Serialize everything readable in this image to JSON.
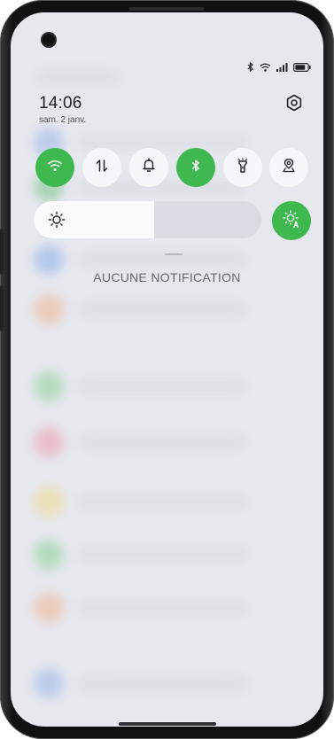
{
  "status_bar": {
    "icons": [
      "bluetooth-icon",
      "wifi-icon",
      "signal-icon",
      "battery-icon"
    ]
  },
  "header": {
    "time": "14:06",
    "date": "sam. 2 janv.",
    "settings_icon": "gear-icon"
  },
  "quick_toggles": [
    {
      "name": "wifi",
      "icon": "wifi-icon",
      "state": "on"
    },
    {
      "name": "mobile-data",
      "icon": "data-arrows-icon",
      "state": "off"
    },
    {
      "name": "sound",
      "icon": "bell-icon",
      "state": "off"
    },
    {
      "name": "bluetooth",
      "icon": "bluetooth-icon",
      "state": "on"
    },
    {
      "name": "flashlight",
      "icon": "flashlight-icon",
      "state": "off"
    },
    {
      "name": "location",
      "icon": "location-icon",
      "state": "off"
    }
  ],
  "brightness": {
    "level": 0.53,
    "auto_icon": "auto-brightness-icon"
  },
  "notifications": {
    "empty_text": "AUCUNE NOTIFICATION"
  },
  "colors": {
    "accent": "#3fb94f",
    "panel": "#e6e8ee",
    "toggle_off": "#f6f7f9"
  }
}
